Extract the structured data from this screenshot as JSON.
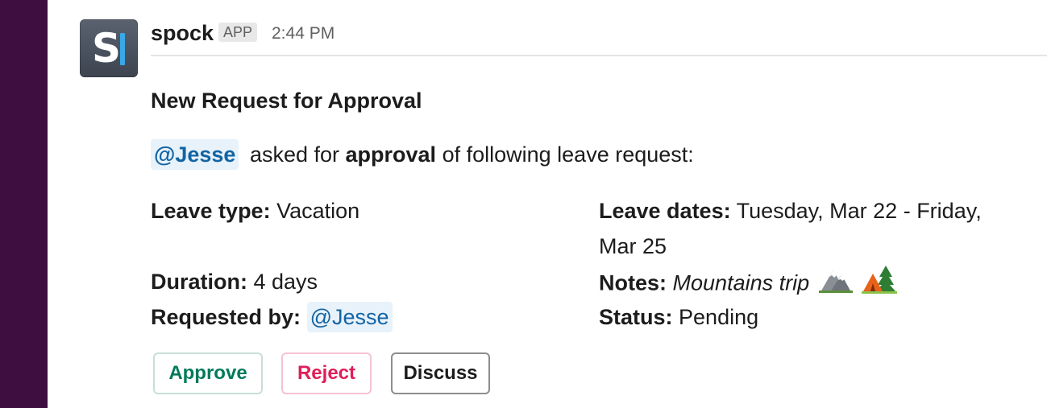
{
  "message": {
    "sender": "spock",
    "badge": "APP",
    "time": "2:44 PM",
    "title": "New Request for Approval",
    "intro": {
      "mention": "@Jesse",
      "text_before_bold": "asked for",
      "bold": "approval",
      "text_after_bold": "of following leave request:"
    },
    "fields": {
      "leave_type": {
        "label": "Leave type:",
        "value": "Vacation"
      },
      "leave_dates": {
        "label": "Leave dates:",
        "value": "Tuesday, Mar 22 - Friday, Mar 25"
      },
      "duration": {
        "label": "Duration:",
        "value": "4 days"
      },
      "notes": {
        "label": "Notes:",
        "value": "Mountains trip"
      },
      "requested_by": {
        "label": "Requested by:",
        "value": "@Jesse"
      },
      "status": {
        "label": "Status:",
        "value": "Pending"
      }
    },
    "notes_emoji": [
      "mountain-emoji",
      "camping-emoji"
    ],
    "buttons": {
      "approve": "Approve",
      "reject": "Reject",
      "discuss": "Discuss"
    }
  },
  "colors": {
    "sidebar": "#3f0e40",
    "mention_text": "#1264a3",
    "mention_bg": "#e8f2fa",
    "approve": "#007a5a",
    "reject": "#e01e5a"
  }
}
